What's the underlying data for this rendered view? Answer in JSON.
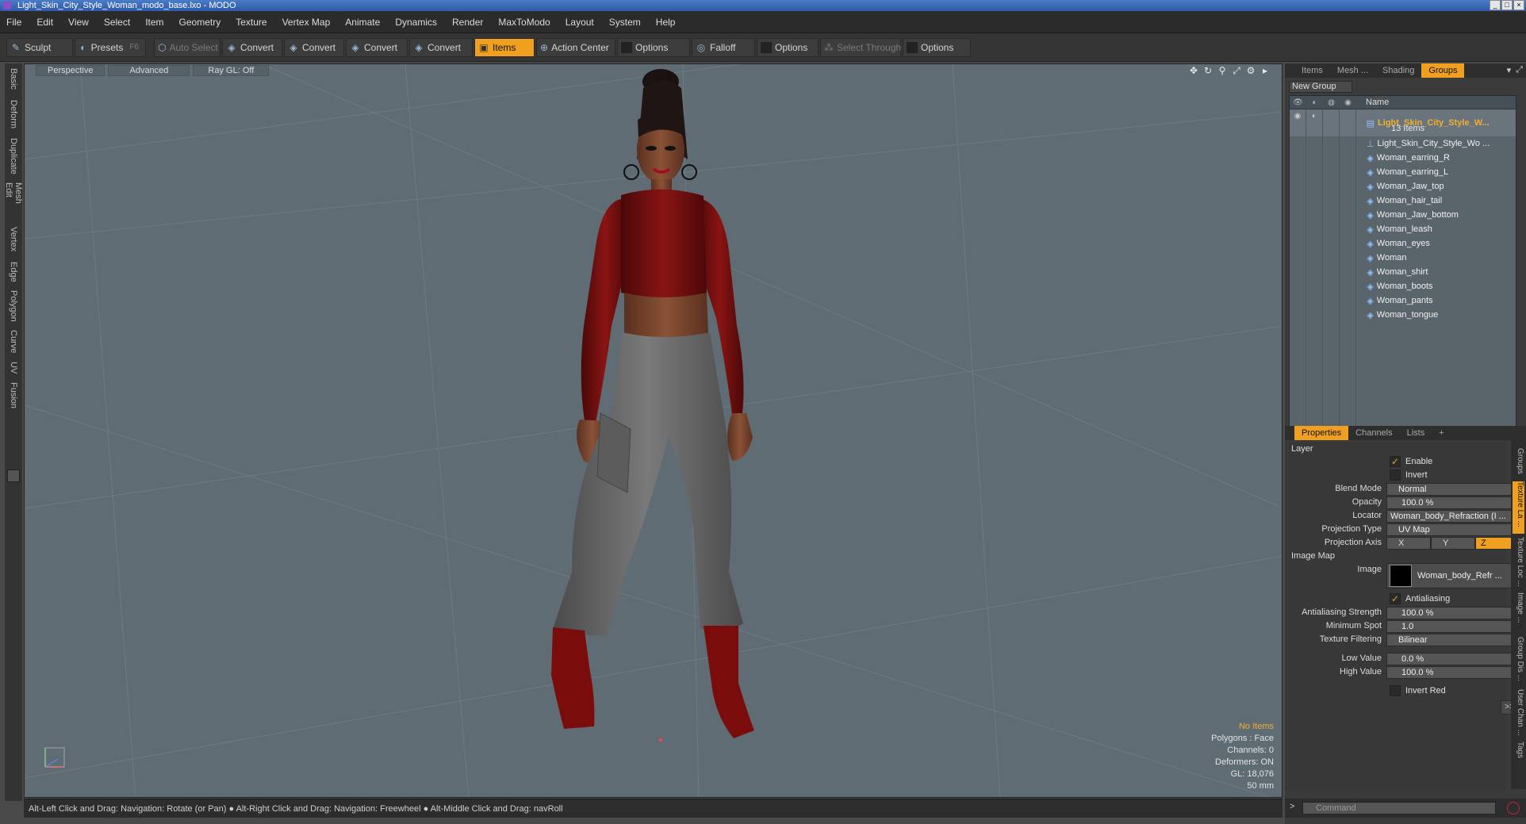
{
  "window": {
    "title": "Light_Skin_City_Style_Woman_modo_base.lxo - MODO",
    "buttons": [
      "_",
      "□",
      "×"
    ]
  },
  "menu": [
    "File",
    "Edit",
    "View",
    "Select",
    "Item",
    "Geometry",
    "Texture",
    "Vertex Map",
    "Animate",
    "Dynamics",
    "Render",
    "MaxToModo",
    "Layout",
    "System",
    "Help"
  ],
  "toolbar": {
    "sculpt": "Sculpt",
    "presets": "Presets",
    "presets_key": "F6",
    "auto_select": "Auto Select",
    "convert1": "Convert",
    "convert2": "Convert",
    "convert3": "Convert",
    "convert4": "Convert",
    "items": "Items",
    "action_center": "Action Center",
    "options1": "Options",
    "falloff": "Falloff",
    "options2": "Options",
    "select_through": "Select Through",
    "options3": "Options"
  },
  "left_tabs": [
    "Basic",
    "Deform",
    "Duplicate",
    "Mesh Edit",
    "Vertex",
    "Edge",
    "Polygon",
    "Curve",
    "UV",
    "Fusion"
  ],
  "viewport": {
    "tabs": [
      "Perspective",
      "Advanced",
      "Ray GL: Off"
    ],
    "info": {
      "items": "No Items",
      "polygons": "Polygons : Face",
      "channels": "Channels: 0",
      "deformers": "Deformers: ON",
      "gl": "GL: 18,076",
      "focal": "50 mm"
    }
  },
  "status": "Alt-Left Click and Drag: Navigation: Rotate (or Pan) ● Alt-Right Click and Drag: Navigation: Freewheel ● Alt-Middle Click and Drag: navRoll",
  "right_panel": {
    "tabs": [
      "Items",
      "Mesh ...",
      "Shading",
      "Groups"
    ],
    "active_tab": "Groups",
    "new_group": "New Group",
    "name_header": "Name",
    "root": {
      "label": "Light_Skin_City_Style_W...",
      "count": "13 Items"
    },
    "items": [
      "Light_Skin_City_Style_Wo ...",
      "Woman_earring_R",
      "Woman_earring_L",
      "Woman_Jaw_top",
      "Woman_hair_tail",
      "Woman_Jaw_bottom",
      "Woman_leash",
      "Woman_eyes",
      "Woman",
      "Woman_shirt",
      "Woman_boots",
      "Woman_pants",
      "Woman_tongue"
    ],
    "prop_tabs": [
      "Properties",
      "Channels",
      "Lists",
      "+"
    ],
    "props": {
      "section_layer": "Layer",
      "enable": "Enable",
      "invert": "Invert",
      "blend_mode_label": "Blend Mode",
      "blend_mode": "Normal",
      "opacity_label": "Opacity",
      "opacity": "100.0 %",
      "locator_label": "Locator",
      "locator": "Woman_body_Refraction (I ...",
      "projection_type_label": "Projection Type",
      "projection_type": "UV Map",
      "projection_axis_label": "Projection Axis",
      "axis_x": "X",
      "axis_y": "Y",
      "axis_z": "Z",
      "section_image": "Image Map",
      "image_label": "Image",
      "image": "Woman_body_Refr ...",
      "antialiasing": "Antialiasing",
      "aa_strength_label": "Antialiasing Strength",
      "aa_strength": "100.0 %",
      "min_spot_label": "Minimum Spot",
      "min_spot": "1.0",
      "filtering_label": "Texture Filtering",
      "filtering": "Bilinear",
      "low_label": "Low Value",
      "low": "0.0 %",
      "high_label": "High Value",
      "high": "100.0 %",
      "invert_red": "Invert Red",
      "more": ">>"
    },
    "side_tabs": [
      "Groups",
      "Texture La ...",
      "Texture Loc ...",
      "Image ...",
      "Group Dis ...",
      "User Chan ...",
      "Tags"
    ],
    "command_placeholder": "Command"
  }
}
